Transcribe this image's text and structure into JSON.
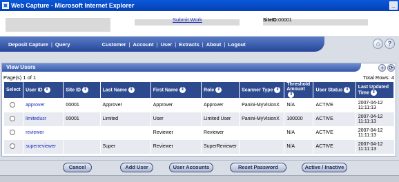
{
  "window": {
    "title": "Web Capture - Microsoft Internet Explorer",
    "minimize": "_"
  },
  "header": {
    "submit_work": "Submit Work",
    "site_id_label": "SiteID:",
    "site_id_value": "00001"
  },
  "nav": {
    "items": [
      "Deposit Capture",
      "Query",
      "Customer",
      "Account",
      "User",
      "Extracts",
      "About",
      "Logout"
    ],
    "sep": "|",
    "home_icon": "home-icon",
    "help_icon": "?"
  },
  "panel": {
    "title": "View Users",
    "add_icon": "+",
    "refresh_icon": "⟳",
    "pages": "Page(s) 1 of 1",
    "total_rows": "Total Rows: 4"
  },
  "table": {
    "columns": [
      "Select",
      "User ID",
      "Site ID",
      "Last Name",
      "First Name",
      "Role",
      "Scanner Type",
      "Threshold Amount",
      "User Status",
      "Last Updated Time"
    ],
    "sort_glyph": "⇕",
    "rows": [
      {
        "user_id": "approver",
        "site_id": "00001",
        "last_name": "Approver",
        "first_name": "Approver",
        "role": "Approver",
        "scanner": "Panini-MyVisionX",
        "threshold": "N/A",
        "status": "ACTIVE",
        "updated_date": "2007-04-12",
        "updated_time": "11:11:13"
      },
      {
        "user_id": "limitedusr",
        "site_id": "00001",
        "last_name": "Limited",
        "first_name": "User",
        "role": "Limited User",
        "scanner": "Panini-MyVisionX",
        "threshold": "100000",
        "status": "ACTIVE",
        "updated_date": "2007-04-12",
        "updated_time": "11:11:13"
      },
      {
        "user_id": "reviewer",
        "site_id": "",
        "last_name": "",
        "first_name": "Reviewer",
        "role": "Reviewer",
        "scanner": "",
        "threshold": "N/A",
        "status": "ACTIVE",
        "updated_date": "2007-04-12",
        "updated_time": "11:11:13"
      },
      {
        "user_id": "superreviewer",
        "site_id": "",
        "last_name": "Super",
        "first_name": "Reviewer",
        "role": "SuperReviewer",
        "scanner": "",
        "threshold": "N/A",
        "status": "ACTIVE",
        "updated_date": "2007-04-12",
        "updated_time": "11:11:13"
      }
    ]
  },
  "buttons": {
    "cancel": "Cancel",
    "add_user": "Add User",
    "user_accounts": "User Accounts",
    "reset_password": "Reset Password",
    "active_inactive": "Active / Inactive"
  }
}
